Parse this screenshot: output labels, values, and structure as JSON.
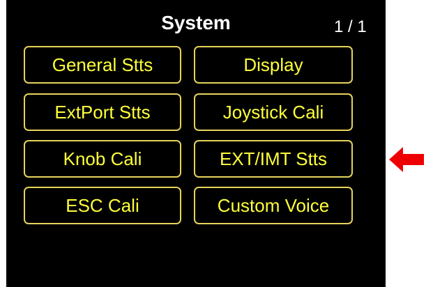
{
  "header": {
    "title": "System",
    "page_indicator": "1 / 1"
  },
  "menu": {
    "items": [
      {
        "label": "General Stts"
      },
      {
        "label": "Display"
      },
      {
        "label": "ExtPort Stts"
      },
      {
        "label": "Joystick Cali"
      },
      {
        "label": "Knob Cali"
      },
      {
        "label": "EXT/IMT Stts"
      },
      {
        "label": "ESC Cali"
      },
      {
        "label": "Custom Voice"
      }
    ]
  },
  "annotation": {
    "arrow_icon": "left-arrow-icon",
    "arrow_color": "#ee0000"
  },
  "colors": {
    "screen_background": "#000000",
    "button_border": "#e6d35a",
    "button_text": "#ffff3a",
    "title_text": "#ffffff"
  }
}
